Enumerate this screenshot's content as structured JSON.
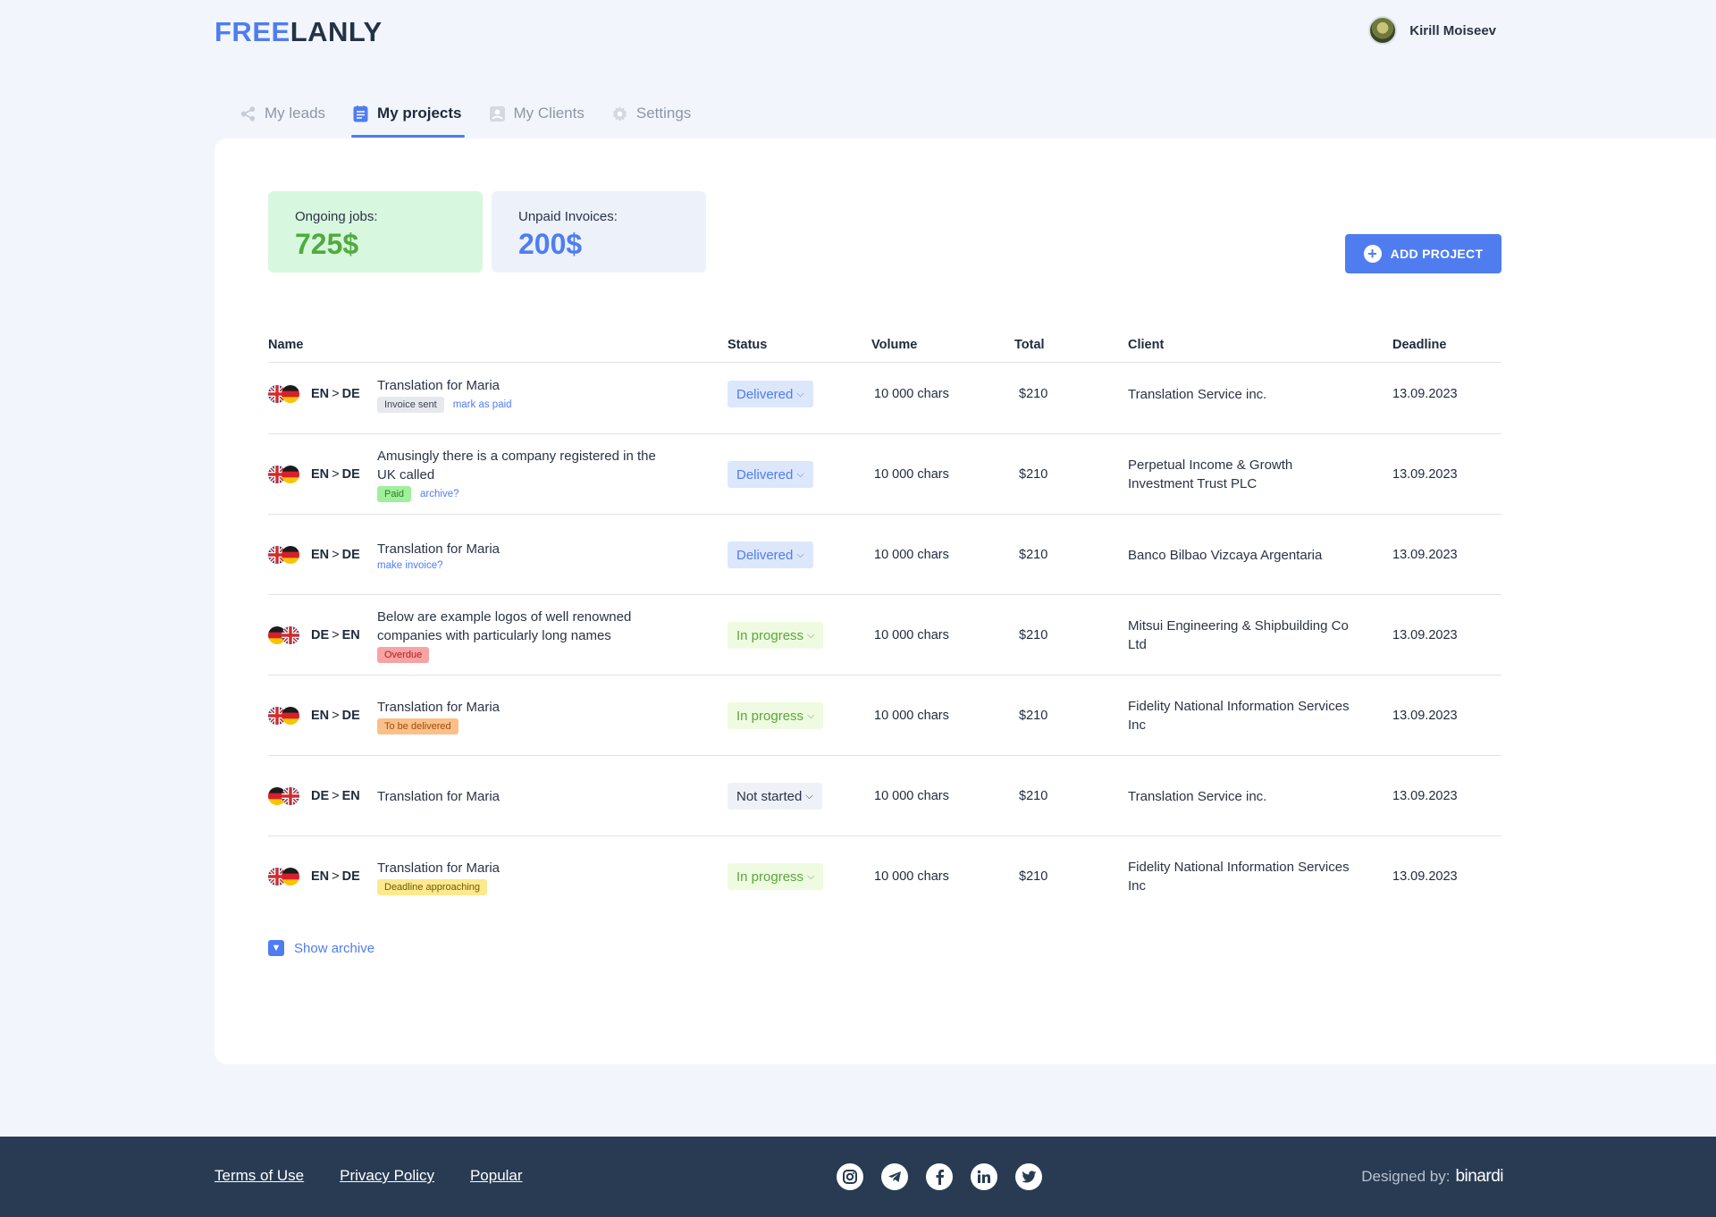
{
  "brand": {
    "part1": "FREE",
    "part2": "LANLY"
  },
  "user": {
    "name": "Kirill Moiseev"
  },
  "tabs": [
    {
      "label": "My leads",
      "icon": "share-icon"
    },
    {
      "label": "My projects",
      "icon": "document-icon"
    },
    {
      "label": "My Clients",
      "icon": "contacts-icon"
    },
    {
      "label": "Settings",
      "icon": "gear-icon"
    }
  ],
  "stats": {
    "ongoing": {
      "label": "Ongoing jobs:",
      "value": "725$"
    },
    "unpaid": {
      "label": "Unpaid Invoices:",
      "value": "200$"
    }
  },
  "add_button": {
    "label": "ADD PROJECT"
  },
  "table": {
    "headers": {
      "name": "Name",
      "status": "Status",
      "volume": "Volume",
      "total": "Total",
      "client": "Client",
      "deadline": "Deadline"
    },
    "rows": [
      {
        "from": "EN",
        "to": "DE",
        "name": "Translation for Maria",
        "badge": "Invoice sent",
        "link": "mark as paid",
        "status": "Delivered",
        "volume": "10 000 chars",
        "total": "$210",
        "client": "Translation Service inc.",
        "deadline": "13.09.2023"
      },
      {
        "from": "EN",
        "to": "DE",
        "name": "Amusingly there is a company registered in the UK called",
        "badge": "Paid",
        "link": "archive?",
        "status": "Delivered",
        "volume": "10 000 chars",
        "total": "$210",
        "client": "Perpetual Income & Growth Investment Trust PLC",
        "deadline": "13.09.2023"
      },
      {
        "from": "EN",
        "to": "DE",
        "name": "Translation for Maria",
        "badge": "",
        "link": "make invoice?",
        "status": "Delivered",
        "volume": "10 000 chars",
        "total": "$210",
        "client": "Banco Bilbao Vizcaya Argentaria",
        "deadline": "13.09.2023"
      },
      {
        "from": "DE",
        "to": "EN",
        "name": "Below are example logos of well renowned companies with particularly long names",
        "badge": "Overdue",
        "link": "",
        "status": "In progress",
        "volume": "10 000 chars",
        "total": "$210",
        "client": "Mitsui Engineering & Shipbuilding Co Ltd",
        "deadline": "13.09.2023"
      },
      {
        "from": "EN",
        "to": "DE",
        "name": "Translation for Maria",
        "badge": "To be delivered",
        "link": "",
        "status": "In progress",
        "volume": "10 000 chars",
        "total": "$210",
        "client": "Fidelity National Information Services Inc",
        "deadline": "13.09.2023"
      },
      {
        "from": "DE",
        "to": "EN",
        "name": "Translation for Maria",
        "badge": "",
        "link": "",
        "status": "Not started",
        "volume": "10 000 chars",
        "total": "$210",
        "client": "Translation Service inc.",
        "deadline": "13.09.2023"
      },
      {
        "from": "EN",
        "to": "DE",
        "name": "Translation for Maria",
        "badge": "Deadline approaching",
        "link": "",
        "status": "In progress",
        "volume": "10 000 chars",
        "total": "$210",
        "client": "Fidelity National Information Services Inc",
        "deadline": "13.09.2023"
      }
    ]
  },
  "archive": {
    "label": "Show archive"
  },
  "footer": {
    "links": [
      "Terms of Use",
      "Privacy Policy",
      "Popular"
    ],
    "socials": [
      "instagram-icon",
      "telegram-icon",
      "facebook-icon",
      "linkedin-icon",
      "twitter-icon"
    ],
    "designed_label": "Designed by:",
    "designer": "binardi"
  },
  "colors": {
    "accent": "#4f7df0",
    "green": "#4fac3c",
    "footer_bg": "#283b52"
  }
}
